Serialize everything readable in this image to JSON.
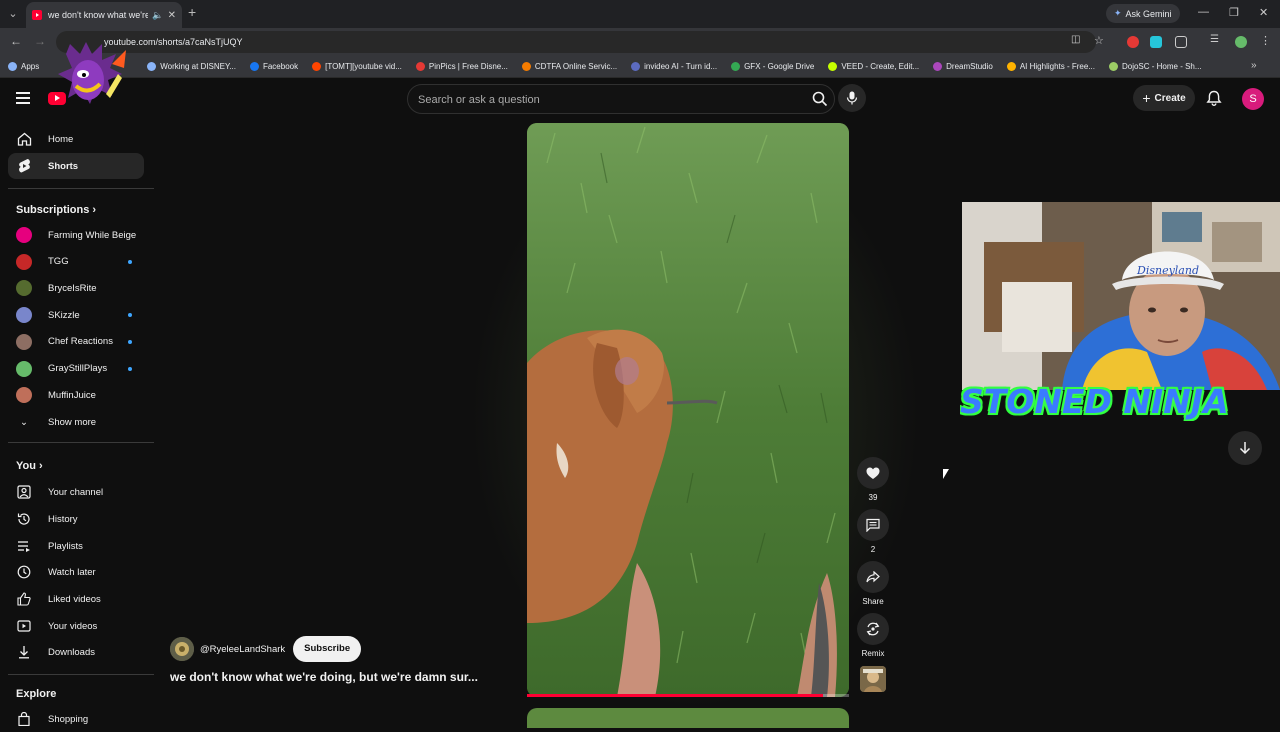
{
  "browser": {
    "tab_title": "we don't know what we're d",
    "new_tab": "+",
    "ask_gemini": "Ask Gemini",
    "url": "youtube.com/shorts/a7caNsTjUQY",
    "bookmarks": [
      {
        "label": "Apps",
        "color": "#8ab4f8"
      },
      {
        "label": "Working at DISNEY...",
        "color": "#8ab4f8"
      },
      {
        "label": "Facebook",
        "color": "#1877f2"
      },
      {
        "label": "[TOMT][youtube vid...",
        "color": "#ff4500"
      },
      {
        "label": "PinPics | Free Disne...",
        "color": "#e53935"
      },
      {
        "label": "CDTFA Online Servic...",
        "color": "#f57c00"
      },
      {
        "label": "invideo AI - Turn id...",
        "color": "#5c6bc0"
      },
      {
        "label": "GFX - Google Drive",
        "color": "#34a853"
      },
      {
        "label": "VEED - Create, Edit...",
        "color": "#c6ff00"
      },
      {
        "label": "DreamStudio",
        "color": "#ab47bc"
      },
      {
        "label": "AI Highlights - Free...",
        "color": "#ffb300"
      },
      {
        "label": "DojoSC - Home - Sh...",
        "color": "#9ccc65"
      }
    ]
  },
  "header": {
    "search_placeholder": "Search or ask a question",
    "create_label": "Create",
    "avatar_letter": "S"
  },
  "sidebar": {
    "main": [
      {
        "label": "Home",
        "icon": "home-icon"
      },
      {
        "label": "Shorts",
        "icon": "shorts-icon",
        "active": true
      }
    ],
    "subscriptions_title": "Subscriptions",
    "subscriptions": [
      {
        "label": "Farming While Beige",
        "color": "#e6007e",
        "live": false
      },
      {
        "label": "TGG",
        "color": "#c62828",
        "live": true
      },
      {
        "label": "BryceIsRite",
        "color": "#556b2f",
        "live": false
      },
      {
        "label": "SKizzle",
        "color": "#7986cb",
        "live": true
      },
      {
        "label": "Chef Reactions",
        "color": "#8d6e63",
        "live": true
      },
      {
        "label": "GrayStillPlays",
        "color": "#66bb6a",
        "live": true
      },
      {
        "label": "MuffinJuice",
        "color": "#bf6f5a",
        "live": false
      }
    ],
    "show_more": "Show more",
    "you_title": "You",
    "you_items": [
      {
        "label": "Your channel",
        "icon": "channel-icon"
      },
      {
        "label": "History",
        "icon": "history-icon"
      },
      {
        "label": "Playlists",
        "icon": "playlists-icon"
      },
      {
        "label": "Watch later",
        "icon": "watch-later-icon"
      },
      {
        "label": "Liked videos",
        "icon": "like-icon"
      },
      {
        "label": "Your videos",
        "icon": "your-videos-icon"
      },
      {
        "label": "Downloads",
        "icon": "download-icon"
      }
    ],
    "explore_title": "Explore",
    "explore_first": "Shopping"
  },
  "short": {
    "channel": "@RyeleeLandShark",
    "subscribe_label": "Subscribe",
    "title": "we don't know what we're doing, but we're damn sur...",
    "likes": "39",
    "comments": "2",
    "share_label": "Share",
    "remix_label": "Remix",
    "progress": 0.92
  },
  "overlay": {
    "streamer_text": "STONED NINJA",
    "hat_text": "Disneyland"
  }
}
